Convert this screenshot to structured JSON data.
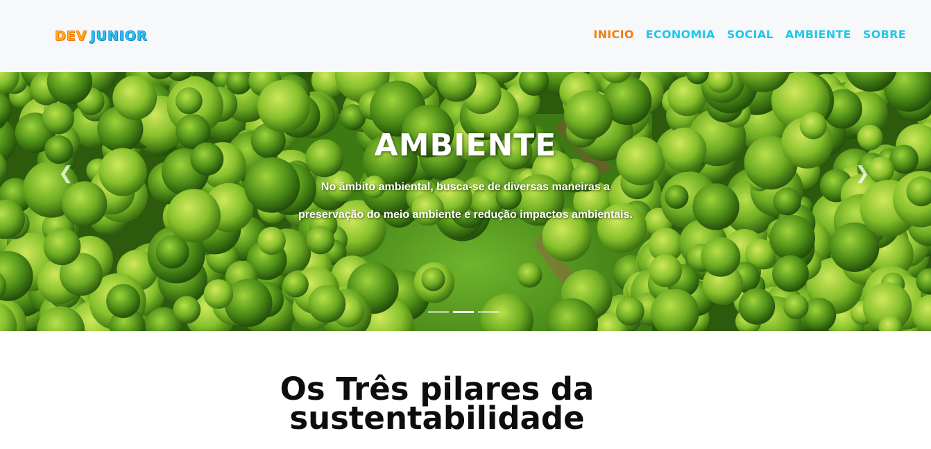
{
  "logo": {
    "dev": "DEV",
    "junior": "JUNIOR"
  },
  "nav": {
    "items": [
      {
        "label": "INICIO"
      },
      {
        "label": "ECONOMIA"
      },
      {
        "label": "SOCIAL"
      },
      {
        "label": "AMBIENTE"
      },
      {
        "label": "SOBRE"
      }
    ]
  },
  "carousel": {
    "title": "AMBIENTE",
    "text_line1": "No âmbito ambiental, busca-se de diversas maneiras a",
    "text_line2": "preservação do meio ambiente e redução impactos ambientais.",
    "prev_icon": "chevron-left-icon",
    "next_icon": "chevron-right-icon",
    "active_slide": 2,
    "slide_count": 3
  },
  "section": {
    "title_line1": "Os Três pilares da",
    "title_line2": "sustentabilidade"
  },
  "colors": {
    "nav_link": "#22c6ea",
    "nav_active": "#f47d0e",
    "navbar_bg": "#f7f8fa",
    "logo_dev": "#ffb21a",
    "logo_junior": "#2fc7f0"
  }
}
